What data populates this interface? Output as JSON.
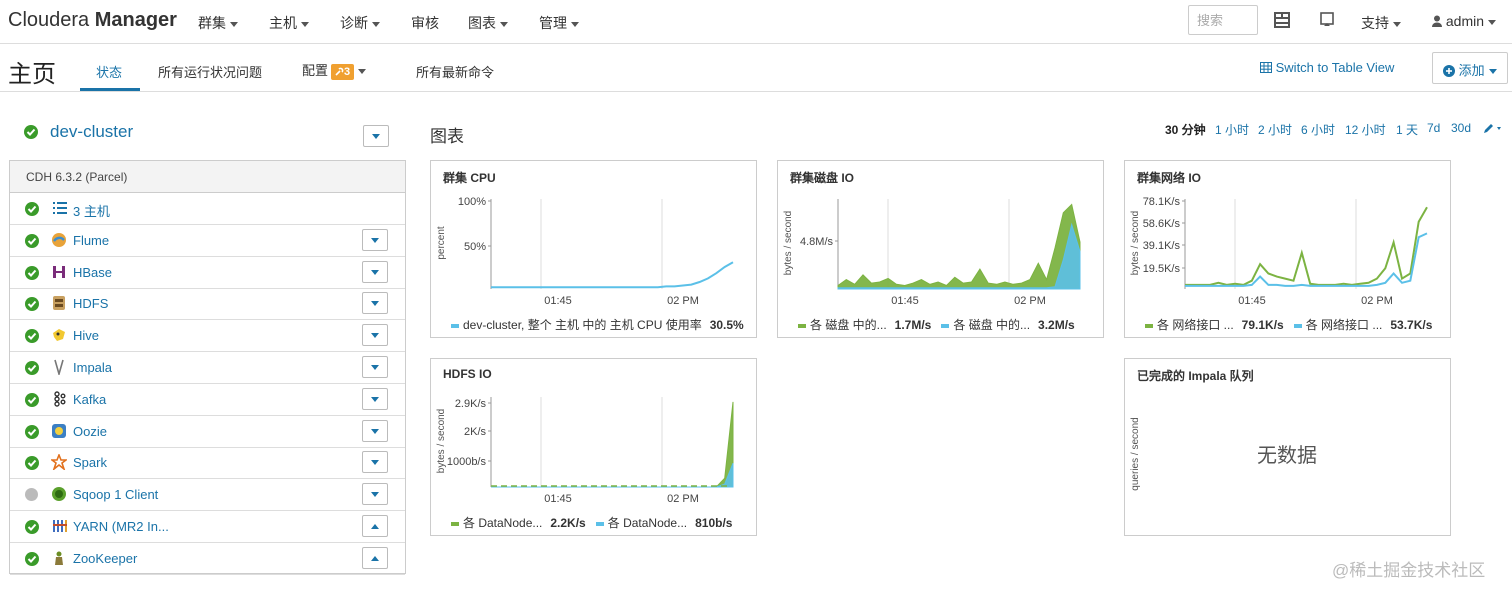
{
  "brand": {
    "light": "Cloudera ",
    "bold": "Manager"
  },
  "topnav": {
    "items": [
      "群集",
      "主机",
      "诊断",
      "审核",
      "图表",
      "管理"
    ],
    "search_placeholder": "搜索",
    "support": "支持",
    "user": "admin"
  },
  "subhead": {
    "title": "主页",
    "tabs": [
      "状态",
      "所有运行状况问题",
      "配置",
      "所有最新命令"
    ],
    "config_badge": "3",
    "switch_view": "Switch to Table View",
    "add": "添加"
  },
  "cluster": {
    "name": "dev-cluster",
    "version": "CDH 6.3.2 (Parcel)",
    "hosts": "3 主机",
    "services": [
      {
        "name": "Flume",
        "status": "good",
        "icon": "flume-icon",
        "expanded": false
      },
      {
        "name": "HBase",
        "status": "good",
        "icon": "hbase-icon",
        "expanded": false
      },
      {
        "name": "HDFS",
        "status": "good",
        "icon": "hdfs-icon",
        "expanded": false
      },
      {
        "name": "Hive",
        "status": "good",
        "icon": "hive-icon",
        "expanded": false
      },
      {
        "name": "Impala",
        "status": "good",
        "icon": "impala-icon",
        "expanded": false
      },
      {
        "name": "Kafka",
        "status": "good",
        "icon": "kafka-icon",
        "expanded": false
      },
      {
        "name": "Oozie",
        "status": "good",
        "icon": "oozie-icon",
        "expanded": false
      },
      {
        "name": "Spark",
        "status": "good",
        "icon": "spark-icon",
        "expanded": false
      },
      {
        "name": "Sqoop 1 Client",
        "status": "none",
        "icon": "sqoop-icon",
        "expanded": false
      },
      {
        "name": "YARN (MR2 In...",
        "status": "good",
        "icon": "yarn-icon",
        "expanded": true
      },
      {
        "name": "ZooKeeper",
        "status": "good",
        "icon": "zookeeper-icon",
        "expanded": true
      }
    ]
  },
  "charts": {
    "title": "图表",
    "ranges": [
      "30 分钟",
      "1 小时",
      "2 小时",
      "6 小时",
      "12 小时",
      "1 天",
      "7d",
      "30d"
    ],
    "active_range": "30 分钟",
    "colors": {
      "green": "#7cb342",
      "blue": "#5bc0e8"
    },
    "nodata": "无数据"
  },
  "chart_data": [
    {
      "type": "line",
      "title": "群集 CPU",
      "ylabel": "percent",
      "ytick_labels": [
        "100%",
        "50%"
      ],
      "xtick_labels": [
        "01:45",
        "02 PM"
      ],
      "ylim": [
        0,
        100
      ],
      "series": [
        {
          "name": "dev-cluster, 整个 主机 中的 主机 CPU 使用率",
          "value_label": "30.5%",
          "color": "#5bc0e8",
          "values": [
            2,
            2,
            2,
            2,
            2,
            2,
            2,
            2,
            2,
            2,
            2,
            2,
            2,
            2,
            2,
            2,
            2,
            2,
            2,
            2,
            2,
            3,
            3,
            4,
            5,
            8,
            12,
            18,
            25,
            30.5
          ]
        }
      ]
    },
    {
      "type": "area",
      "title": "群集磁盘 IO",
      "ylabel": "bytes / second",
      "ytick_labels": [
        "4.8M/s"
      ],
      "xtick_labels": [
        "01:45",
        "02 PM"
      ],
      "ylim": [
        0,
        7.5
      ],
      "series": [
        {
          "name": "各 磁盘 中的...",
          "value_label": "1.7M/s",
          "color": "#7cb342",
          "values": [
            0.3,
            0.8,
            0.4,
            1.2,
            0.5,
            0.6,
            0.9,
            0.4,
            0.3,
            0.5,
            0.8,
            0.4,
            0.6,
            0.3,
            1.0,
            0.5,
            0.6,
            1.7,
            0.5,
            0.4,
            0.6,
            0.4,
            0.5,
            0.8,
            2.2,
            0.8,
            3.5,
            6.5,
            7.2,
            4.0
          ]
        },
        {
          "name": "各 磁盘 中的...",
          "value_label": "3.2M/s",
          "color": "#5bc0e8",
          "values": [
            0.1,
            0.1,
            0.1,
            0.1,
            0.1,
            0.1,
            0.1,
            0.1,
            0.1,
            0.1,
            0.1,
            0.1,
            0.1,
            0.1,
            0.1,
            0.1,
            0.1,
            0.1,
            0.1,
            0.1,
            0.1,
            0.1,
            0.1,
            0.1,
            0.1,
            0.1,
            0.2,
            2.5,
            5.5,
            3.2
          ]
        }
      ]
    },
    {
      "type": "line",
      "title": "群集网络 IO",
      "ylabel": "bytes / second",
      "ytick_labels": [
        "78.1K/s",
        "58.6K/s",
        "39.1K/s",
        "19.5K/s"
      ],
      "xtick_labels": [
        "01:45",
        "02 PM"
      ],
      "ylim": [
        0,
        85
      ],
      "series": [
        {
          "name": "各 网络接口 ...",
          "value_label": "79.1K/s",
          "color": "#7cb342",
          "values": [
            4,
            4,
            4,
            4,
            6,
            4,
            5,
            4,
            8,
            24,
            15,
            12,
            10,
            8,
            35,
            5,
            4,
            4,
            4,
            5,
            4,
            5,
            6,
            10,
            20,
            45,
            10,
            15,
            65,
            79
          ]
        },
        {
          "name": "各 网络接口 ...",
          "value_label": "53.7K/s",
          "color": "#5bc0e8",
          "values": [
            3,
            3,
            3,
            3,
            3,
            3,
            3,
            3,
            4,
            12,
            4,
            4,
            3,
            3,
            4,
            3,
            3,
            3,
            3,
            3,
            3,
            3,
            3,
            4,
            6,
            15,
            6,
            8,
            50,
            53.7
          ]
        }
      ]
    },
    {
      "type": "area",
      "title": "HDFS IO",
      "ylabel": "bytes / second",
      "ytick_labels": [
        "2.9K/s",
        "2K/s",
        "1000b/s"
      ],
      "xtick_labels": [
        "01:45",
        "02 PM"
      ],
      "ylim": [
        0,
        3000
      ],
      "series": [
        {
          "name": "各 DataNode...",
          "value_label": "2.2K/s",
          "color": "#7cb342",
          "values": [
            0,
            0,
            0,
            0,
            0,
            0,
            0,
            0,
            0,
            0,
            0,
            0,
            0,
            0,
            0,
            0,
            0,
            0,
            0,
            0,
            0,
            0,
            0,
            0,
            0,
            0,
            0,
            0,
            300,
            2900
          ]
        },
        {
          "name": "各 DataNode...",
          "value_label": "810b/s",
          "color": "#5bc0e8",
          "values": [
            0,
            0,
            0,
            0,
            0,
            0,
            0,
            0,
            0,
            0,
            0,
            0,
            0,
            0,
            0,
            0,
            0,
            0,
            0,
            0,
            0,
            0,
            0,
            0,
            0,
            0,
            0,
            0,
            100,
            810
          ]
        }
      ]
    },
    {
      "type": "line",
      "title": "已完成的 Impala 队列",
      "ylabel": "queries / second",
      "series": []
    }
  ],
  "watermark": "@稀土掘金技术社区"
}
